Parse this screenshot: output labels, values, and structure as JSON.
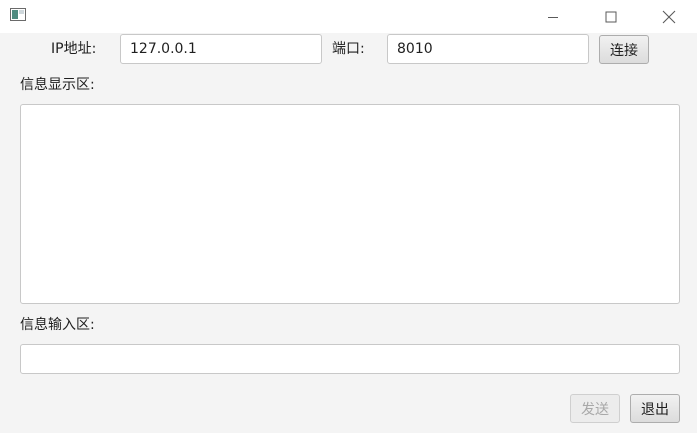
{
  "window": {
    "title": "",
    "controls": [
      "minimize-icon",
      "maximize-icon",
      "close-icon"
    ]
  },
  "connection": {
    "ip_label": "IP地址:",
    "ip_value": "127.0.0.1",
    "port_label": "端口:",
    "port_value": "8010",
    "connect_label": "连接"
  },
  "display": {
    "label": "信息显示区:",
    "content": ""
  },
  "input": {
    "label": "信息输入区:",
    "value": ""
  },
  "actions": {
    "send_label": "发送",
    "exit_label": "退出"
  },
  "colors": {
    "window_bg": "#f4f4f4",
    "titlebar_bg": "#ffffff",
    "field_border": "#c8c8c8",
    "disabled_text": "#a8a8a8"
  }
}
